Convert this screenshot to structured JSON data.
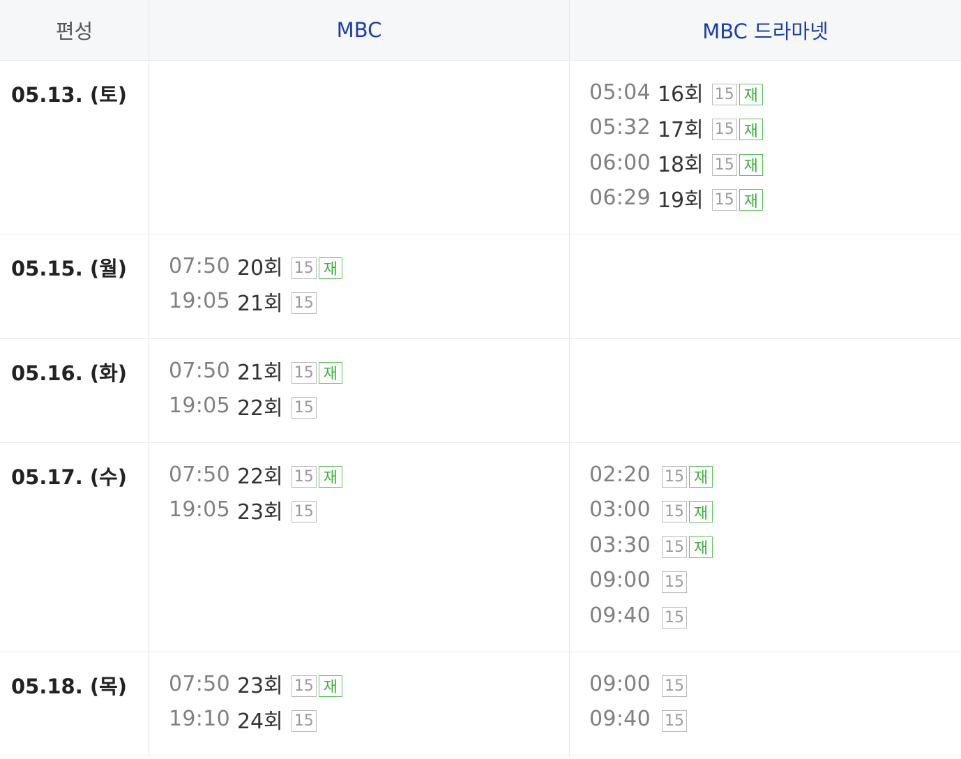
{
  "header": {
    "first": "편성",
    "channels": [
      "MBC",
      "MBC 드라마넷"
    ]
  },
  "badges": {
    "age": "15",
    "rerun": "재"
  },
  "rows": [
    {
      "date": "05.13. (토)",
      "mbc": [],
      "net": [
        {
          "time": "05:04",
          "ep": "16회",
          "rerun": true
        },
        {
          "time": "05:32",
          "ep": "17회",
          "rerun": true
        },
        {
          "time": "06:00",
          "ep": "18회",
          "rerun": true
        },
        {
          "time": "06:29",
          "ep": "19회",
          "rerun": true
        }
      ]
    },
    {
      "date": "05.15. (월)",
      "mbc": [
        {
          "time": "07:50",
          "ep": "20회",
          "rerun": true
        },
        {
          "time": "19:05",
          "ep": "21회",
          "rerun": false
        }
      ],
      "net": []
    },
    {
      "date": "05.16. (화)",
      "mbc": [
        {
          "time": "07:50",
          "ep": "21회",
          "rerun": true
        },
        {
          "time": "19:05",
          "ep": "22회",
          "rerun": false
        }
      ],
      "net": []
    },
    {
      "date": "05.17. (수)",
      "mbc": [
        {
          "time": "07:50",
          "ep": "22회",
          "rerun": true
        },
        {
          "time": "19:05",
          "ep": "23회",
          "rerun": false
        }
      ],
      "net": [
        {
          "time": "02:20",
          "ep": "",
          "rerun": true
        },
        {
          "time": "03:00",
          "ep": "",
          "rerun": true
        },
        {
          "time": "03:30",
          "ep": "",
          "rerun": true
        },
        {
          "time": "09:00",
          "ep": "",
          "rerun": false
        },
        {
          "time": "09:40",
          "ep": "",
          "rerun": false
        }
      ]
    },
    {
      "date": "05.18. (목)",
      "mbc": [
        {
          "time": "07:50",
          "ep": "23회",
          "rerun": true
        },
        {
          "time": "19:10",
          "ep": "24회",
          "rerun": false
        }
      ],
      "net": [
        {
          "time": "09:00",
          "ep": "",
          "rerun": false
        },
        {
          "time": "09:40",
          "ep": "",
          "rerun": false
        }
      ]
    }
  ]
}
